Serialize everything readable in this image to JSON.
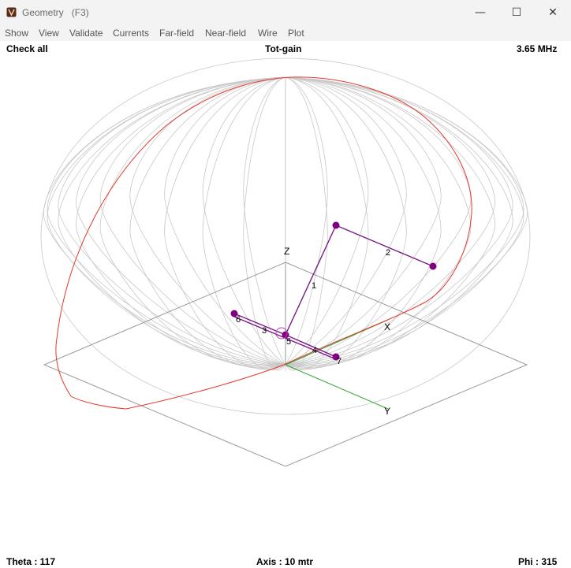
{
  "window": {
    "title": "Geometry",
    "shortcut": "(F3)",
    "minimize_glyph": "—",
    "maximize_glyph": "☐",
    "close_glyph": "✕"
  },
  "menu": [
    "Show",
    "View",
    "Validate",
    "Currents",
    "Far-field",
    "Near-field",
    "Wire",
    "Plot"
  ],
  "info": {
    "left": "Check all",
    "center": "Tot-gain",
    "right": "3.65 MHz"
  },
  "axes": {
    "z_label": "Z",
    "x_label": "X",
    "y_label": "Y"
  },
  "wire_labels": [
    "1",
    "2",
    "3",
    "4",
    "5",
    "6",
    "7"
  ],
  "status": {
    "theta": "Theta : 117",
    "axis": "Axis : 10 mtr",
    "phi": "Phi : 315"
  },
  "colors": {
    "mesh": "#c8c8c8",
    "cut": "#e8382c",
    "wire": "#7a1a86",
    "node": "#800080",
    "axis_green": "#2ea82e",
    "ground": "#999999"
  }
}
